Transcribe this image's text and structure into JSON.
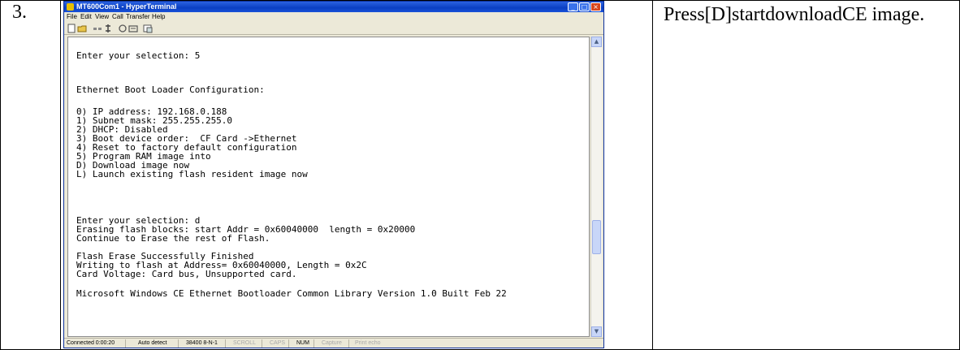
{
  "step": {
    "number": "3."
  },
  "instruction": {
    "text": "Press[D]startdownloadCE image."
  },
  "window": {
    "title": "MT600Com1 - HyperTerminal",
    "menu": [
      "File",
      "Edit",
      "View",
      "Call",
      "Transfer",
      "Help"
    ],
    "toolbar_icons": [
      "new-icon",
      "open-icon",
      "disconnect-icon",
      "properties-icon",
      "call-icon",
      "hangup-icon",
      "properties-sheet-icon"
    ],
    "terminal_lines": [
      "Enter your selection: 5",
      "",
      "",
      "Ethernet Boot Loader Configuration:",
      "",
      "0) IP address: 192.168.0.188",
      "1) Subnet mask: 255.255.255.0",
      "2) DHCP: Disabled",
      "3) Boot device order:  CF Card ->Ethernet",
      "4) Reset to factory default configuration",
      "5) Program RAM image into",
      "D) Download image now",
      "L) Launch existing flash resident image now",
      "",
      "",
      "",
      "Enter your selection: d",
      "Erasing flash blocks: start Addr = 0x60040000  length = 0x20000",
      "Continue to Erase the rest of Flash.",
      "",
      "Flash Erase Successfully Finished",
      "Writing to flash at Address= 0x60040000, Length = 0x2C",
      "Card Voltage: Card bus, Unsupported card.",
      "",
      "Microsoft Windows CE Ethernet Bootloader Common Library Version 1.0 Built Feb 22"
    ],
    "status": {
      "connected": "Connected 0:00:20",
      "detect": "Auto detect",
      "port_settings": "38400 8-N-1",
      "scroll": "SCROLL",
      "caps": "CAPS",
      "num": "NUM",
      "capture": "Capture",
      "print_echo": "Print echo"
    }
  }
}
